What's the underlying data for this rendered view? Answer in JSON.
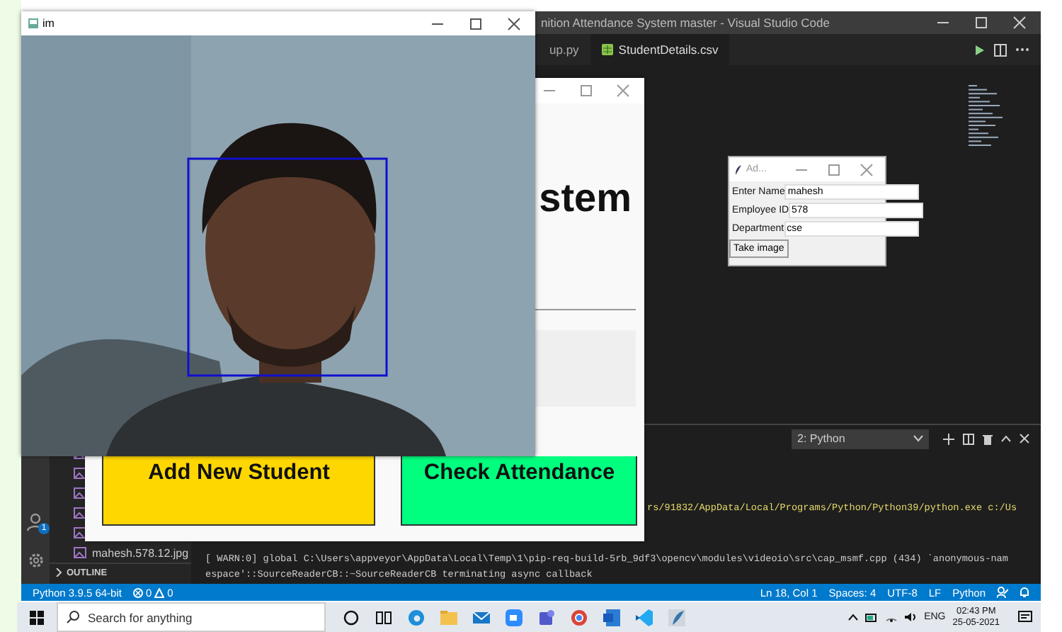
{
  "vscode": {
    "title": "nition Attendance System master - Visual Studio Code",
    "tabs": [
      {
        "label": "up.py",
        "selected": false
      },
      {
        "label": "StudentDetails.csv",
        "selected": true
      }
    ],
    "account_badge": "1",
    "explorer": {
      "files": [
        "mahesh.578.12.jpg"
      ],
      "outline": "OUTLINE"
    },
    "terminal": {
      "dropdown": "2: Python",
      "lines": [
        "rs/91832/AppData/Local/Programs/Python/Python39/python.exe c:/Us",
        "[ WARN:0] global C:\\Users\\appveyor\\AppData\\Local\\Temp\\1\\pip-req-build-5rb_9df3\\opencv\\modules\\videoio\\src\\cap_msmf.cpp (434) `anonymous-nam",
        "espace'::SourceReaderCB::~SourceReaderCB terminating async callback"
      ]
    },
    "status_bar": {
      "interpreter": "Python 3.9.5 64-bit",
      "errors": "0",
      "warnings": "0",
      "position": "Ln 18, Col 1",
      "spaces": "Spaces: 4",
      "encoding": "UTF-8",
      "eol": "LF",
      "language": "Python"
    }
  },
  "app_window": {
    "heading": "stem",
    "buttons": [
      {
        "label": "Add New Student",
        "color": "#ffd700"
      },
      {
        "label": "Check Attendance",
        "color": "#00ff7f"
      }
    ]
  },
  "dialog": {
    "title": "Ad...",
    "fields": [
      {
        "label": "Enter Name",
        "value": "mahesh"
      },
      {
        "label": "Employee ID",
        "value": "578"
      },
      {
        "label": "Department",
        "value": "cse"
      }
    ],
    "button": "Take image"
  },
  "camera_window": {
    "title": "im",
    "kind": "picture"
  },
  "taskbar": {
    "search_placeholder": "Search for anything",
    "language": "ENG",
    "time": "02:43 PM",
    "date": "25-05-2021"
  }
}
